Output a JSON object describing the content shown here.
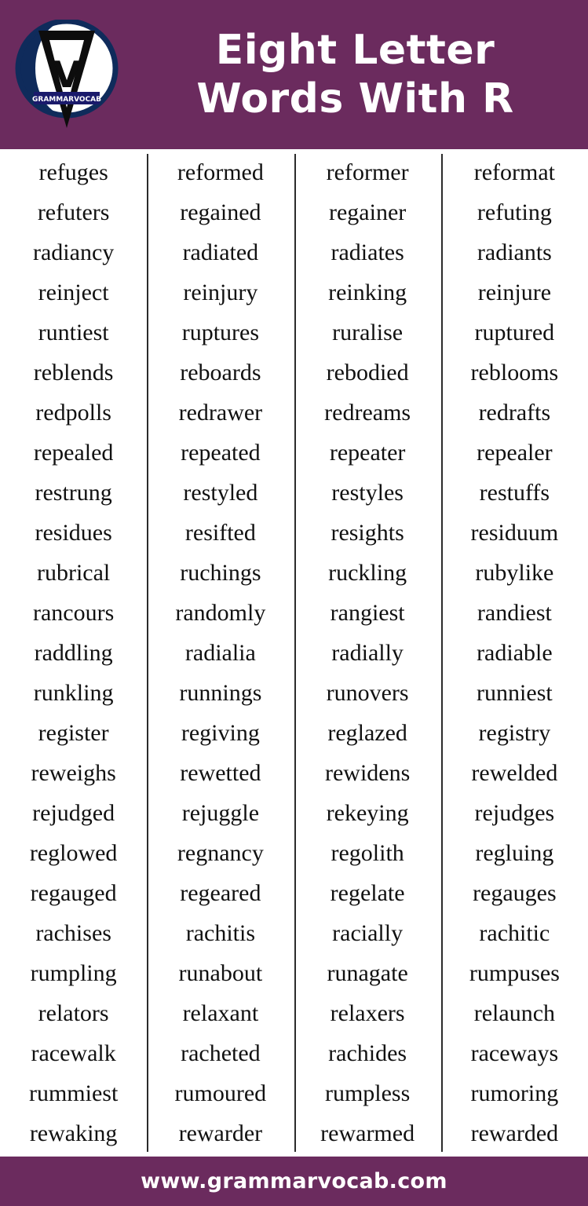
{
  "header": {
    "title_line1": "Eight Letter",
    "title_line2": "Words With R",
    "background_color": "#6b2b5e",
    "logo": {
      "name": "grammarvocab-logo",
      "brand_text": "GRAMMARVOCAB",
      "letter": "V",
      "circle_color": "#0f2b5b"
    }
  },
  "footer": {
    "url": "www.grammarvocab.com",
    "background_color": "#6b2b5e"
  },
  "columns": [
    {
      "words": [
        "refuges",
        "refuters",
        "radiancy",
        "reinject",
        "runtiest",
        "reblends",
        "redpolls",
        "repealed",
        "restrung",
        "residues",
        "rubrical",
        "rancours",
        "raddling",
        "runkling",
        "register",
        "reweighs",
        "rejudged",
        "reglowed",
        "regauged",
        "rachises",
        "rumpling",
        "relators",
        "racewalk",
        "rummiest",
        "rewaking"
      ]
    },
    {
      "words": [
        "reformed",
        "regained",
        "radiated",
        "reinjury",
        "ruptures",
        "reboards",
        "redrawer",
        "repeated",
        "restyled",
        "resifted",
        "ruchings",
        "randomly",
        "radialia",
        "runnings",
        "regiving",
        "rewetted",
        "rejuggle",
        "regnancy",
        "regeared",
        "rachitis",
        "runabout",
        "relaxant",
        "racheted",
        "rumoured",
        "rewarder"
      ]
    },
    {
      "words": [
        "reformer",
        "regainer",
        "radiates",
        "reinking",
        "ruralise",
        "rebodied",
        "redreams",
        "repeater",
        "restyles",
        "resights",
        "ruckling",
        "rangiest",
        "radially",
        "runovers",
        "reglazed",
        "rewidens",
        "rekeying",
        "regolith",
        "regelate",
        "racially",
        "runagate",
        "relaxers",
        "rachides",
        "rumpless",
        "rewarmed"
      ]
    },
    {
      "words": [
        "reformat",
        "refuting",
        "radiants",
        "reinjure",
        "ruptured",
        "reblooms",
        "redrafts",
        "repealer",
        "restuffs",
        "residuum",
        "rubylike",
        "randiest",
        "radiable",
        "runniest",
        "registry",
        "rewelded",
        "rejudges",
        "regluing",
        "regauges",
        "rachitic",
        "rumpuses",
        "relaunch",
        "raceways",
        "rumoring",
        "rewarded"
      ]
    }
  ]
}
